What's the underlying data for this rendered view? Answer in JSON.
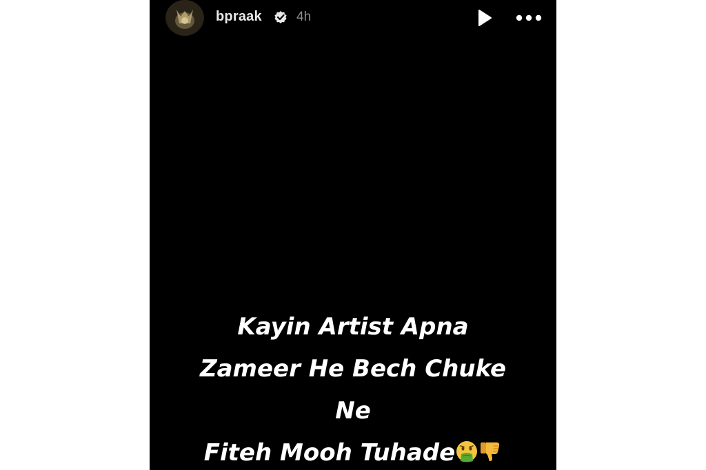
{
  "header": {
    "username": "bpraak",
    "time_ago": "4h",
    "avatar_icon": "avatar-image",
    "verified_icon": "verified-badge-icon",
    "play_icon": "play-icon",
    "more_icon": "more-options-icon"
  },
  "story": {
    "background_color": "#000000",
    "caption_lines": [
      "Kayin Artist Apna",
      "Zameer He Bech Chuke",
      "Ne",
      "Fiteh Mooh Tuhade"
    ],
    "caption_emojis": [
      "nauseated-face-icon",
      "thumbs-down-icon"
    ]
  }
}
